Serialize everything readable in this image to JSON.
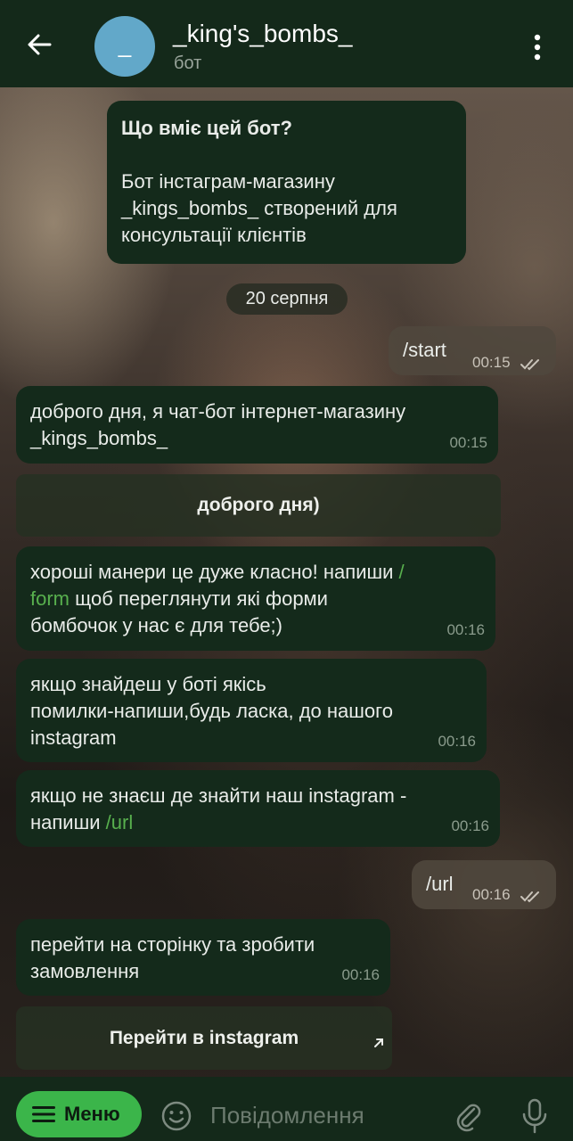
{
  "header": {
    "back_icon": "arrow-left-icon",
    "avatar_letter": "_",
    "avatar_color": "#62a8c9",
    "title": "_king's_bombs_",
    "subtitle": "бот",
    "menu_icon": "more-vertical-icon"
  },
  "intro": {
    "heading": "Що вміє цей бот?",
    "body_lines": [
      "Бот інстаграм-магазину",
      "_kings_bombs_ створений для",
      "консультації клієнтів"
    ]
  },
  "date_label": "20 серпня",
  "messages": {
    "out1": {
      "text": "/start",
      "time": "00:15"
    },
    "in1": {
      "line1": "доброго дня, я чат-бот інтернет-магазину",
      "line2": "_kings_bombs_",
      "time": "00:15"
    },
    "kb1": {
      "label": "доброго дня)"
    },
    "in2": {
      "line1_pre": "хороші манери це дуже класно! напиши ",
      "line1_cmd": "/",
      "line2_cmd": "form",
      "line2_post": " щоб переглянути які форми",
      "line3": "бомбочок у нас є для тебе;)",
      "time": "00:16"
    },
    "in3": {
      "line1": "якщо знайдеш у боті якісь",
      "line2": "помилки-напиши,будь ласка, до нашого",
      "line3": "instagram",
      "time": "00:16"
    },
    "in4": {
      "line1": "якщо не знаєш де знайти наш instagram -",
      "line2_pre": "напиши ",
      "line2_cmd": "/url",
      "time": "00:16"
    },
    "out2": {
      "text": "/url",
      "time": "00:16"
    },
    "in5": {
      "line1": "перейти на сторінку та зробити",
      "line2": "замовлення",
      "time": "00:16"
    },
    "kb2": {
      "label": "Перейти в instagram"
    }
  },
  "bottom": {
    "menu_label": "Меню",
    "placeholder": "Повідомлення",
    "emoji_icon": "emoji-icon",
    "attach_icon": "paperclip-icon",
    "mic_icon": "microphone-icon"
  },
  "colors": {
    "header_bg": "#14291a",
    "bubble_bg": "#142a1b",
    "command_link": "#58b04e",
    "menu_button": "#3bb54a"
  }
}
